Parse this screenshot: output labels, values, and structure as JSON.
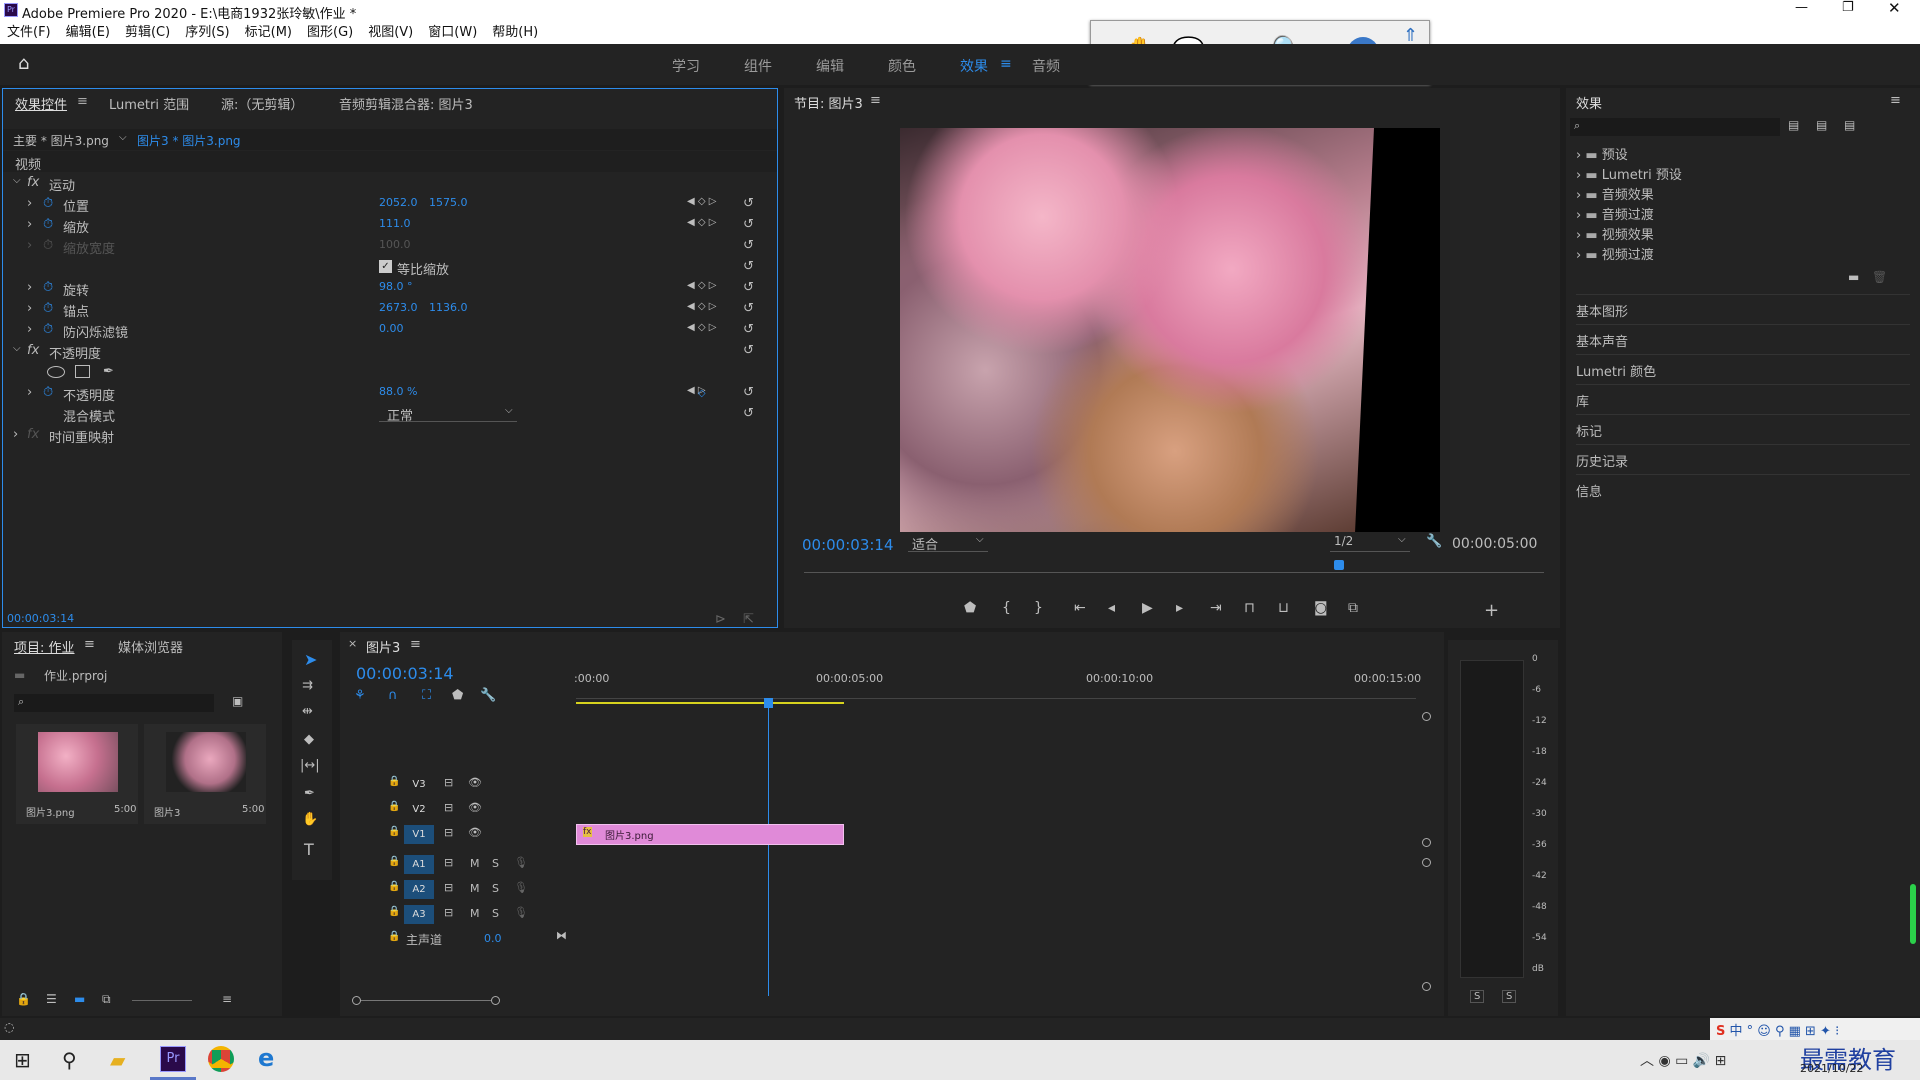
{
  "titlebar": {
    "title": "Adobe Premiere Pro 2020 - E:\\电商1932张玲敏\\作业 *"
  },
  "menu": [
    "文件(F)",
    "编辑(E)",
    "剪辑(C)",
    "序列(S)",
    "标记(M)",
    "图形(G)",
    "视图(V)",
    "窗口(W)",
    "帮助(H)"
  ],
  "workspaces": [
    "学习",
    "组件",
    "编辑",
    "颜色",
    "效果",
    "音频"
  ],
  "active_workspace": "效果",
  "effect_controls": {
    "tabs": [
      "效果控件",
      "Lumetri 范围",
      "源:（无剪辑）",
      "音频剪辑混合器: 图片3"
    ],
    "master": "主要 * 图片3.png",
    "clip": "图片3 * 图片3.png",
    "video_label": "视频",
    "motion": "运动",
    "position_label": "位置",
    "position_x": "2052.0",
    "position_y": "1575.0",
    "scale_label": "缩放",
    "scale": "111.0",
    "scale_width_label": "缩放宽度",
    "scale_width": "100.0",
    "uniform_label": "等比缩放",
    "rotation_label": "旋转",
    "rotation": "98.0 °",
    "anchor_label": "锚点",
    "anchor_x": "2673.0",
    "anchor_y": "1136.0",
    "antiflicker_label": "防闪烁滤镜",
    "antiflicker": "0.00",
    "opacity_group": "不透明度",
    "opacity_label": "不透明度",
    "opacity": "88.0 %",
    "blend_label": "混合模式",
    "blend": "正常",
    "time_remap": "时间重映射",
    "timecode": "00:00:03:14"
  },
  "program": {
    "title": "节目: 图片3",
    "timecode": "00:00:03:14",
    "fit": "适合",
    "res": "1/2",
    "duration": "00:00:05:00"
  },
  "effects_panel": {
    "title": "效果",
    "tree": [
      "预设",
      "Lumetri 预设",
      "音频效果",
      "音频过渡",
      "视频效果",
      "视频过渡"
    ],
    "sections": [
      "基本图形",
      "基本声音",
      "Lumetri 颜色",
      "库",
      "标记",
      "历史记录",
      "信息"
    ]
  },
  "project": {
    "tabs": [
      "项目: 作业",
      "媒体浏览器"
    ],
    "file": "作业.prproj",
    "items": [
      {
        "name": "图片3.png",
        "dur": "5:00"
      },
      {
        "name": "图片3",
        "dur": "5:00"
      }
    ]
  },
  "timeline": {
    "seq": "图片3",
    "timecode": "00:00:03:14",
    "ruler": [
      ":00:00",
      "00:00:05:00",
      "00:00:10:00",
      "00:00:15:00"
    ],
    "video_tracks": [
      "V3",
      "V2",
      "V1"
    ],
    "audio_tracks": [
      "A1",
      "A2",
      "A3"
    ],
    "master": "主声道",
    "master_val": "0.0",
    "clip": "图片3.png"
  },
  "meter": {
    "labels": [
      "0",
      "-6",
      "-12",
      "-18",
      "-24",
      "-30",
      "-36",
      "-42",
      "-48",
      "-54",
      "dB"
    ]
  },
  "taskbar": {
    "date": "2021/10/22",
    "brand": "最需教育"
  }
}
